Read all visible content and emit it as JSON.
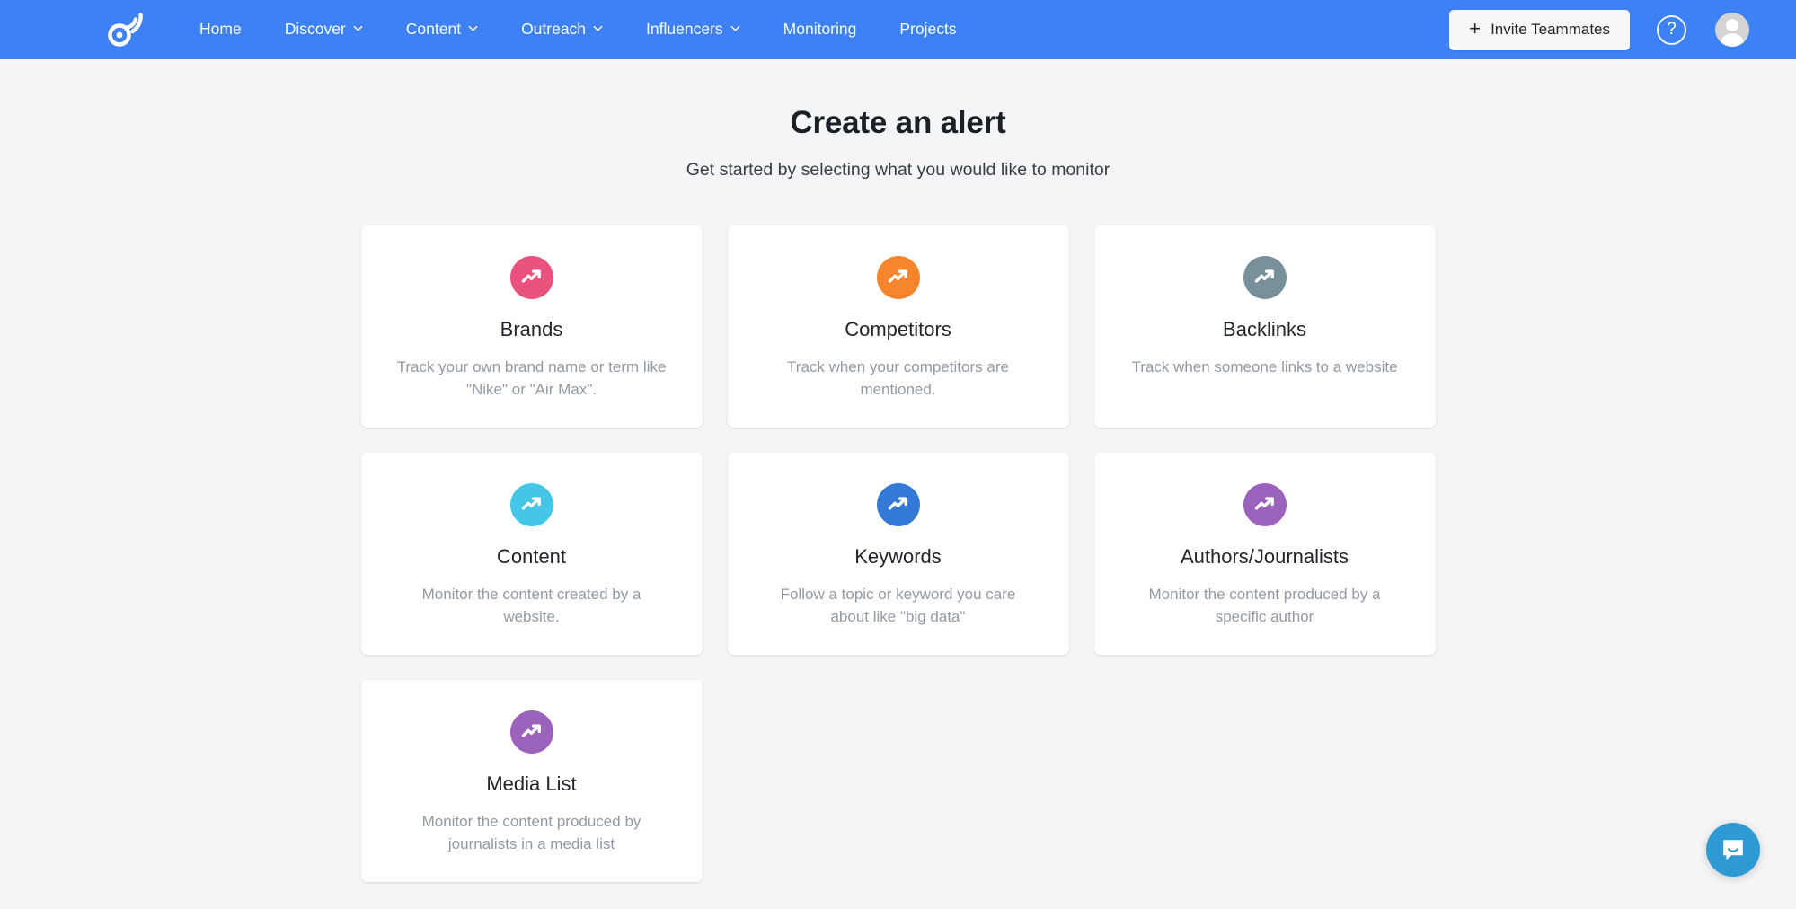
{
  "navbar": {
    "logo_name": "buzzsumo-logo",
    "background_color": "#3d81f5",
    "links": [
      {
        "label": "Home",
        "has_dropdown": false
      },
      {
        "label": "Discover",
        "has_dropdown": true
      },
      {
        "label": "Content",
        "has_dropdown": true
      },
      {
        "label": "Outreach",
        "has_dropdown": true
      },
      {
        "label": "Influencers",
        "has_dropdown": true
      },
      {
        "label": "Monitoring",
        "has_dropdown": false
      },
      {
        "label": "Projects",
        "has_dropdown": false
      }
    ],
    "invite_button_label": "Invite Teammates",
    "invite_button_plus": "+",
    "help_icon_glyph": "?",
    "avatar_name": "user-avatar"
  },
  "page": {
    "title": "Create an alert",
    "subtitle": "Get started by selecting what you would like to monitor"
  },
  "cards": [
    {
      "title": "Brands",
      "description": "Track your own brand name or term like \"Nike\" or \"Air Max\".",
      "icon_name": "trending-up-icon",
      "icon_color": "#e8527d"
    },
    {
      "title": "Competitors",
      "description": "Track when your competitors are mentioned.",
      "icon_name": "trending-up-icon",
      "icon_color": "#f5862e"
    },
    {
      "title": "Backlinks",
      "description": "Track when someone links to a website",
      "icon_name": "trending-up-icon",
      "icon_color": "#78909c"
    },
    {
      "title": "Content",
      "description": "Monitor the content created by a website.",
      "icon_name": "trending-up-icon",
      "icon_color": "#45c5e8"
    },
    {
      "title": "Keywords",
      "description": "Follow a topic or keyword you care about like \"big data\"",
      "icon_name": "trending-up-icon",
      "icon_color": "#3479d6"
    },
    {
      "title": "Authors/Journalists",
      "description": "Monitor the content produced by a specific author",
      "icon_name": "trending-up-icon",
      "icon_color": "#9b62bb"
    },
    {
      "title": "Media List",
      "description": "Monitor the content produced by journalists in a media list",
      "icon_name": "trending-up-icon",
      "icon_color": "#9b62bb"
    }
  ],
  "intercom": {
    "icon_name": "intercom-chat-icon",
    "color": "#2e9ad4"
  }
}
